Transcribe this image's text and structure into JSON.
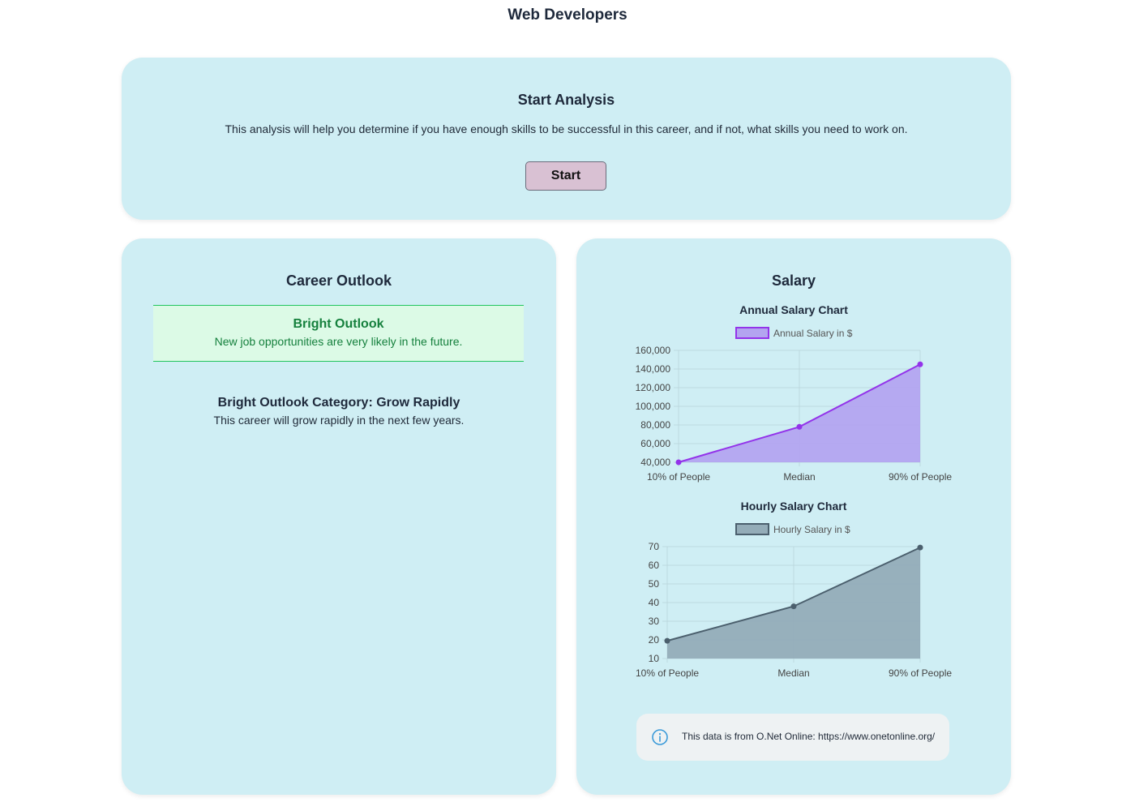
{
  "page": {
    "title": "Web Developers"
  },
  "start": {
    "title": "Start Analysis",
    "description": "This analysis will help you determine if you have enough skills to be successful in this career, and if not, what skills you need to work on.",
    "button_label": "Start"
  },
  "outlook": {
    "title": "Career Outlook",
    "banner_title": "Bright Outlook",
    "banner_text": "New job opportunities are very likely in the future.",
    "category_title": "Bright Outlook Category: Grow Rapidly",
    "category_text": "This career will grow rapidly in the next few years."
  },
  "salary": {
    "title": "Salary",
    "info_text": "This data is from O.Net Online: https://www.onetonline.org/",
    "info_icon": "info-icon"
  },
  "colors": {
    "card_bg": "#cfeef4",
    "annual_line": "#9333ea",
    "annual_fill": "#b3a4f0",
    "hourly_line": "#4b5f6d",
    "hourly_fill": "#94acb8",
    "outlook_green": "#15803d"
  },
  "chart_data": [
    {
      "type": "area",
      "title": "Annual Salary Chart",
      "categories": [
        "10% of People",
        "Median",
        "90% of People"
      ],
      "series": [
        {
          "name": "Annual Salary in $",
          "values": [
            40000,
            78000,
            145000
          ]
        }
      ],
      "ylim": [
        40000,
        160000
      ],
      "yticks": [
        40000,
        60000,
        80000,
        100000,
        120000,
        140000,
        160000
      ],
      "ytick_labels": [
        "40,000",
        "60,000",
        "80,000",
        "100,000",
        "120,000",
        "140,000",
        "160,000"
      ],
      "grid": true,
      "legend": "top"
    },
    {
      "type": "area",
      "title": "Hourly Salary Chart",
      "categories": [
        "10% of People",
        "Median",
        "90% of People"
      ],
      "series": [
        {
          "name": "Hourly Salary in $",
          "values": [
            19.5,
            38,
            69.5
          ]
        }
      ],
      "ylim": [
        10,
        70
      ],
      "yticks": [
        10,
        20,
        30,
        40,
        50,
        60,
        70
      ],
      "ytick_labels": [
        "10",
        "20",
        "30",
        "40",
        "50",
        "60",
        "70"
      ],
      "grid": true,
      "legend": "top"
    }
  ]
}
